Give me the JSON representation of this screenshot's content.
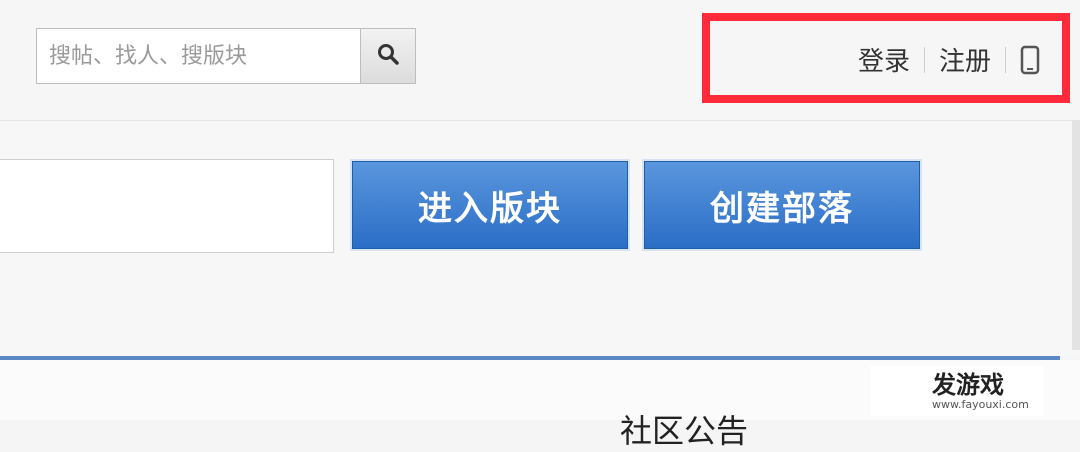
{
  "header": {
    "search": {
      "placeholder": "搜帖、找人、搜版块",
      "button_icon": "search-icon"
    },
    "user_links": {
      "login": "登录",
      "register": "注册",
      "mobile_icon": "mobile-phone-icon",
      "highlight_color": "#ff2b3a"
    }
  },
  "main": {
    "forum_input": {
      "value": ""
    },
    "enter_forum_label": "进入版块",
    "create_tribe_label": "创建部落",
    "accent_color": "#2b6ec7"
  },
  "notice": {
    "title": "社区公告"
  },
  "watermark": {
    "brand": "发游戏",
    "url": "www.fayouxi.com"
  }
}
